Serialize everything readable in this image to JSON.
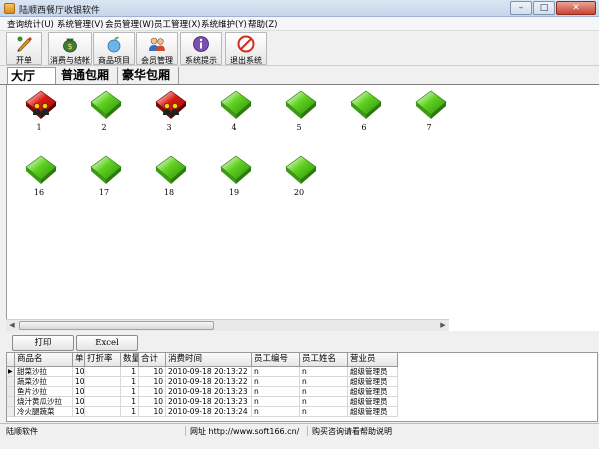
{
  "window": {
    "title": "陆顺西餐厅收银软件",
    "min_label": "–",
    "max_label": "□",
    "close_label": "✕"
  },
  "menu": [
    "查询统计(U)",
    "系统管理(V)",
    "会员管理(W)",
    "员工管理(X)",
    "系统维护(Y)",
    "帮助(Z)"
  ],
  "toolbar": [
    {
      "label": "开单",
      "icon": "pen-icon"
    },
    {
      "label": "消费与结帐",
      "icon": "money-bag-icon"
    },
    {
      "label": "商品项目",
      "icon": "fruit-icon"
    },
    {
      "label": "会员管理",
      "icon": "members-icon"
    },
    {
      "label": "系统提示",
      "icon": "info-icon"
    },
    {
      "label": "退出系统",
      "icon": "exit-icon"
    }
  ],
  "room_tabs": [
    "大厅",
    "普通包厢",
    "豪华包厢"
  ],
  "tables": [
    {
      "number": "1",
      "status": "occupied"
    },
    {
      "number": "2",
      "status": "free"
    },
    {
      "number": "3",
      "status": "occupied"
    },
    {
      "number": "4",
      "status": "free"
    },
    {
      "number": "5",
      "status": "free"
    },
    {
      "number": "6",
      "status": "free"
    },
    {
      "number": "7",
      "status": "free"
    },
    {
      "number": "16",
      "status": "free"
    },
    {
      "number": "17",
      "status": "free"
    },
    {
      "number": "18",
      "status": "free"
    },
    {
      "number": "19",
      "status": "free"
    },
    {
      "number": "20",
      "status": "free"
    }
  ],
  "colors": {
    "free": "#5fd21f",
    "occupied": "#d91b12"
  },
  "buttons": {
    "print": "打印",
    "excel": "Excel"
  },
  "order_columns": [
    "商品名",
    "单价",
    "打折率",
    "数量",
    "合计",
    "消费时间",
    "员工编号",
    "员工姓名",
    "营业员"
  ],
  "order_rows": [
    [
      "甜菜沙拉",
      "10",
      "",
      "1",
      "10",
      "2010-09-18 20:13:22",
      "n",
      "n",
      "超级管理员"
    ],
    [
      "蔬菜沙拉",
      "10",
      "",
      "1",
      "10",
      "2010-09-18 20:13:22",
      "n",
      "n",
      "超级管理员"
    ],
    [
      "鱼片沙拉",
      "10",
      "",
      "1",
      "10",
      "2010-09-18 20:13:23",
      "n",
      "n",
      "超级管理员"
    ],
    [
      "烧汁黄瓜沙拉",
      "10",
      "",
      "1",
      "10",
      "2010-09-18 20:13:23",
      "n",
      "n",
      "超级管理员"
    ],
    [
      "冷火腿蔬菜",
      "10",
      "",
      "1",
      "10",
      "2010-09-18 20:13:24",
      "n",
      "n",
      "超级管理员"
    ]
  ],
  "status": {
    "left": "陆顺软件",
    "url": "网址 http://www.soft166.cn/",
    "help": "购买咨询请看帮助说明"
  }
}
